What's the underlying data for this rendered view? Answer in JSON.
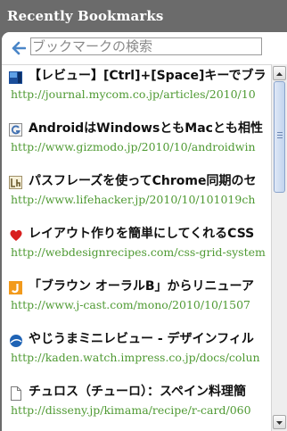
{
  "header": {
    "title": "Recently Bookmarks"
  },
  "search": {
    "placeholder": "ブックマークの検索"
  },
  "bookmarks": [
    {
      "icon": "mycom-icon",
      "title": "【レビュー】[Ctrl]+[Space]キーでブラ",
      "url": "http://journal.mycom.co.jp/articles/2010/10"
    },
    {
      "icon": "gizmodo-icon",
      "title": "AndroidはWindowsともMacとも相性",
      "url": "http://www.gizmodo.jp/2010/10/androidwin"
    },
    {
      "icon": "lifehacker-icon",
      "title": "パスフレーズを使ってChrome同期のセ",
      "url": "http://www.lifehacker.jp/2010/10/101019ch"
    },
    {
      "icon": "heart-icon",
      "title": "レイアウト作りを簡単にしてくれるCSS",
      "url": "http://webdesignrecipes.com/css-grid-system"
    },
    {
      "icon": "jcast-icon",
      "title": "「ブラウン オーラルB」からリニューア",
      "url": "http://www.j-cast.com/mono/2010/10/1507"
    },
    {
      "icon": "impress-icon",
      "title": "やじうまミニレビュー - デザインフィル",
      "url": "http://kaden.watch.impress.co.jp/docs/colun"
    },
    {
      "icon": "page-icon",
      "title": "チュロス（チューロ）：スペイン料理簡",
      "url": "http://disseny.jp/kimama/recipe/r-card/060"
    }
  ]
}
